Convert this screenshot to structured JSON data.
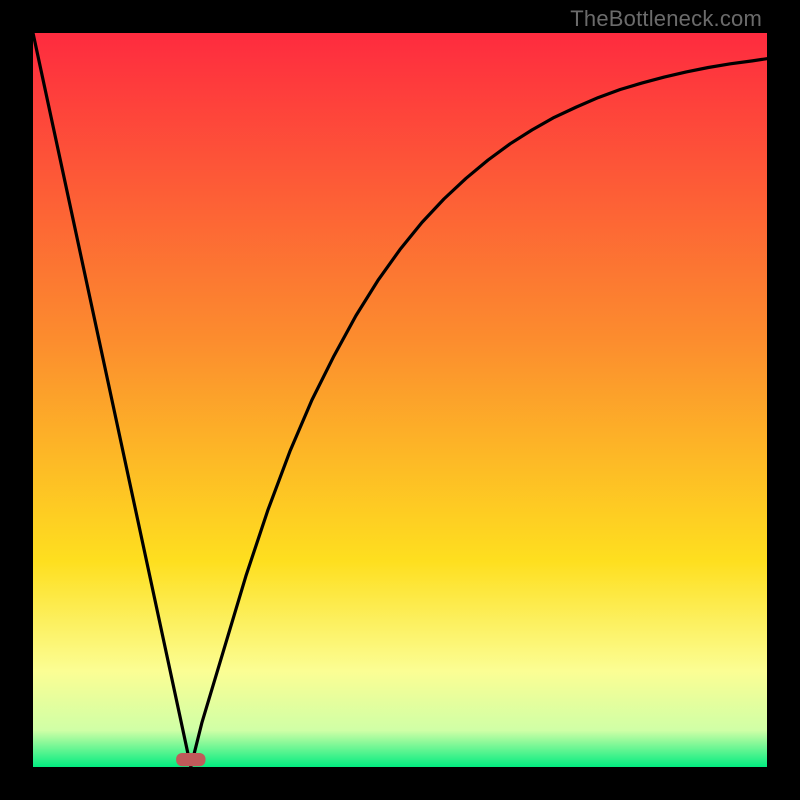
{
  "watermark": "TheBottleneck.com",
  "chart_data": {
    "type": "line",
    "title": "",
    "xlabel": "",
    "ylabel": "",
    "xlim": [
      0,
      100
    ],
    "ylim": [
      0,
      100
    ],
    "legend_position": "none",
    "grid": false,
    "background_gradient": {
      "top": "#fe2b3f",
      "mid1": "#fc8d2e",
      "mid2": "#fedf1f",
      "mid3": "#fbfe94",
      "mid4": "#d0ffa6",
      "bottom": "#02ec80"
    },
    "marker": {
      "x": 21.5,
      "y": 1,
      "fill": "#c05a5a",
      "width": 4,
      "height": 1.8
    },
    "series": [
      {
        "name": "curve",
        "color": "#000000",
        "x": [
          0,
          4,
          8,
          12,
          16,
          20,
          21.5,
          23,
          26,
          29,
          32,
          35,
          38,
          41,
          44,
          47,
          50,
          53,
          56,
          59,
          62,
          65,
          68,
          71,
          74,
          77,
          80,
          83,
          86,
          89,
          92,
          95,
          98,
          100
        ],
        "values": [
          100,
          81.4,
          62.8,
          44.2,
          25.6,
          7,
          0,
          6,
          16,
          26,
          35,
          43,
          50,
          56,
          61.5,
          66.3,
          70.5,
          74.2,
          77.4,
          80.2,
          82.7,
          84.9,
          86.8,
          88.5,
          89.9,
          91.2,
          92.3,
          93.2,
          94,
          94.7,
          95.3,
          95.8,
          96.2,
          96.5
        ]
      }
    ]
  }
}
